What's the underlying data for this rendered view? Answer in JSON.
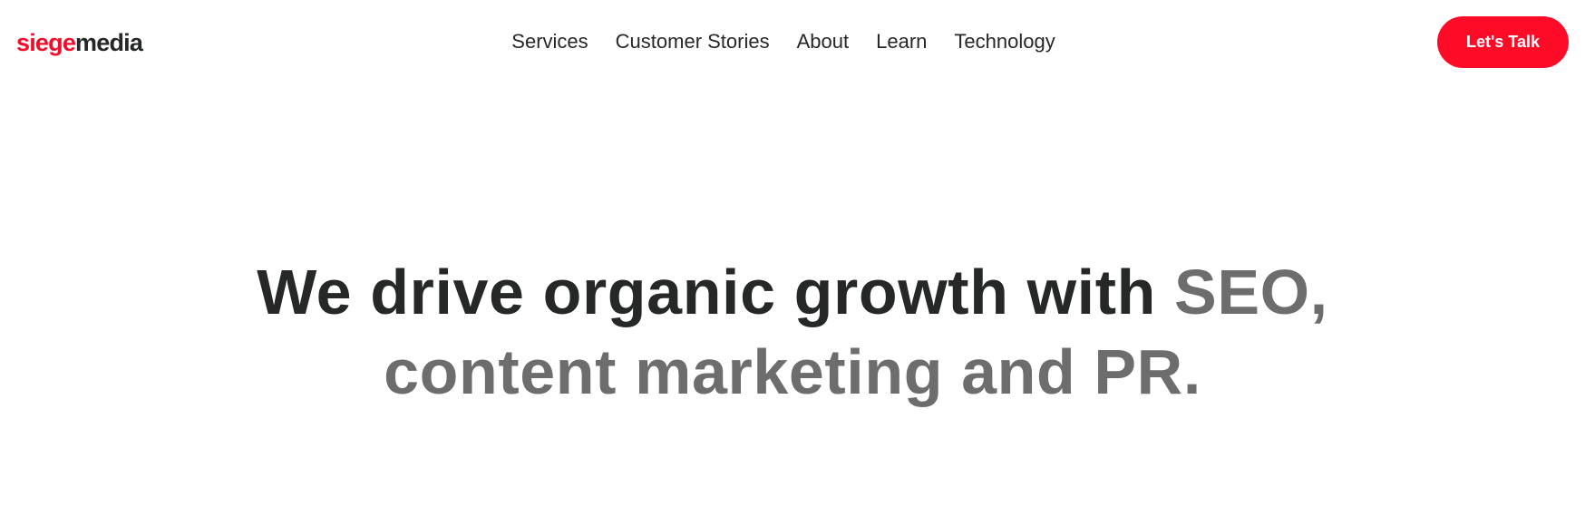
{
  "header": {
    "logo": {
      "part1": "siege",
      "part2": "media"
    },
    "nav": [
      {
        "label": "Services"
      },
      {
        "label": "Customer Stories"
      },
      {
        "label": "About"
      },
      {
        "label": "Learn"
      },
      {
        "label": "Technology"
      }
    ],
    "cta_label": "Let's Talk"
  },
  "hero": {
    "headline_dark": "We drive organic growth with ",
    "headline_grey_line1": "SEO,",
    "headline_grey_line2": "content marketing and PR."
  },
  "colors": {
    "brand_red": "#fe0b28",
    "text_dark": "#262828",
    "text_grey": "#6d6d6d",
    "background": "#ffffff"
  }
}
